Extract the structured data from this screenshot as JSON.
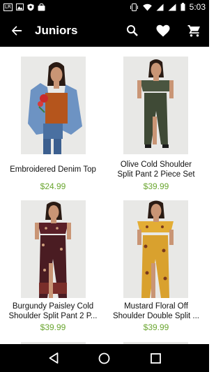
{
  "status_bar": {
    "time": "5:03",
    "left_icons": [
      "lr-badge-icon",
      "image-icon",
      "shield-icon",
      "bag-icon"
    ],
    "lr_badge": "LR",
    "right_icons": [
      "vibrate-icon",
      "wifi-icon",
      "signal-icon",
      "signal-h-icon",
      "battery-icon"
    ]
  },
  "app_bar": {
    "title": "Juniors",
    "back_icon": "arrow-back-icon",
    "actions": [
      "search-icon",
      "heart-icon",
      "cart-icon"
    ]
  },
  "products": [
    {
      "name": "Embroidered Denim Top",
      "name_line2": "",
      "price": "$24.99"
    },
    {
      "name": "Olive Cold Shoulder",
      "name_line2": "Split Pant 2 Piece Set",
      "price": "$39.99"
    },
    {
      "name": "Burgundy Paisley Cold",
      "name_line2": "Shoulder Split Pant 2 P...",
      "price": "$39.99"
    },
    {
      "name": "Mustard Floral Off",
      "name_line2": "Shoulder Double Split ...",
      "price": "$39.99"
    }
  ],
  "nav_bar": {
    "icons": [
      "nav-back-icon",
      "nav-home-icon",
      "nav-recents-icon"
    ]
  },
  "colors": {
    "bar_bg": "#000000",
    "price": "#6aa630",
    "text": "#111111"
  }
}
